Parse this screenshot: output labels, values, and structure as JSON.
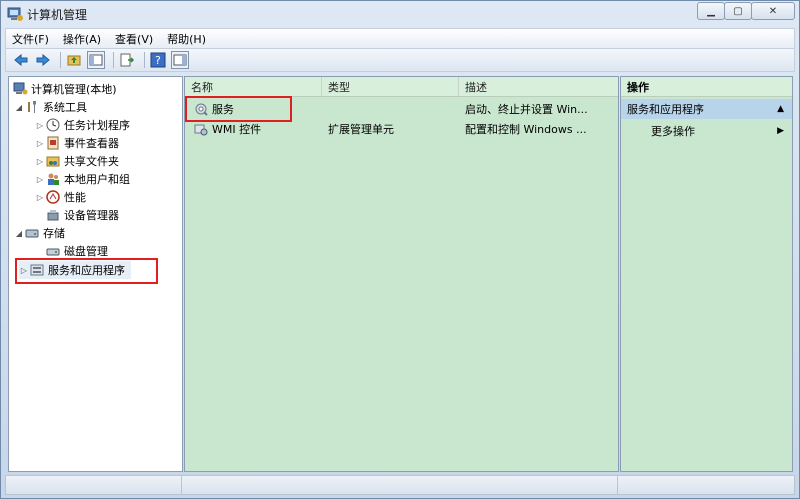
{
  "window": {
    "title": "计算机管理"
  },
  "menubar": {
    "items": [
      "文件(F)",
      "操作(A)",
      "查看(V)",
      "帮助(H)"
    ]
  },
  "tree": {
    "root": "计算机管理(本地)",
    "system_tools": "系统工具",
    "task_scheduler": "任务计划程序",
    "event_viewer": "事件查看器",
    "shared_folders": "共享文件夹",
    "local_users": "本地用户和组",
    "performance": "性能",
    "device_manager": "设备管理器",
    "storage": "存储",
    "disk_management": "磁盘管理",
    "services_apps": "服务和应用程序"
  },
  "list": {
    "columns": [
      "名称",
      "类型",
      "描述"
    ],
    "rows": [
      {
        "name": "服务",
        "type": "",
        "desc": "启动、终止并设置 Win..."
      },
      {
        "name": "WMI 控件",
        "type": "扩展管理单元",
        "desc": "配置和控制 Windows ..."
      }
    ]
  },
  "actions": {
    "header": "操作",
    "section": "服务和应用程序",
    "more": "更多操作"
  },
  "colors": {
    "pane_green": "#c9e7cf",
    "highlight_red": "#e02020",
    "selection_blue": "#b8d4ea"
  }
}
